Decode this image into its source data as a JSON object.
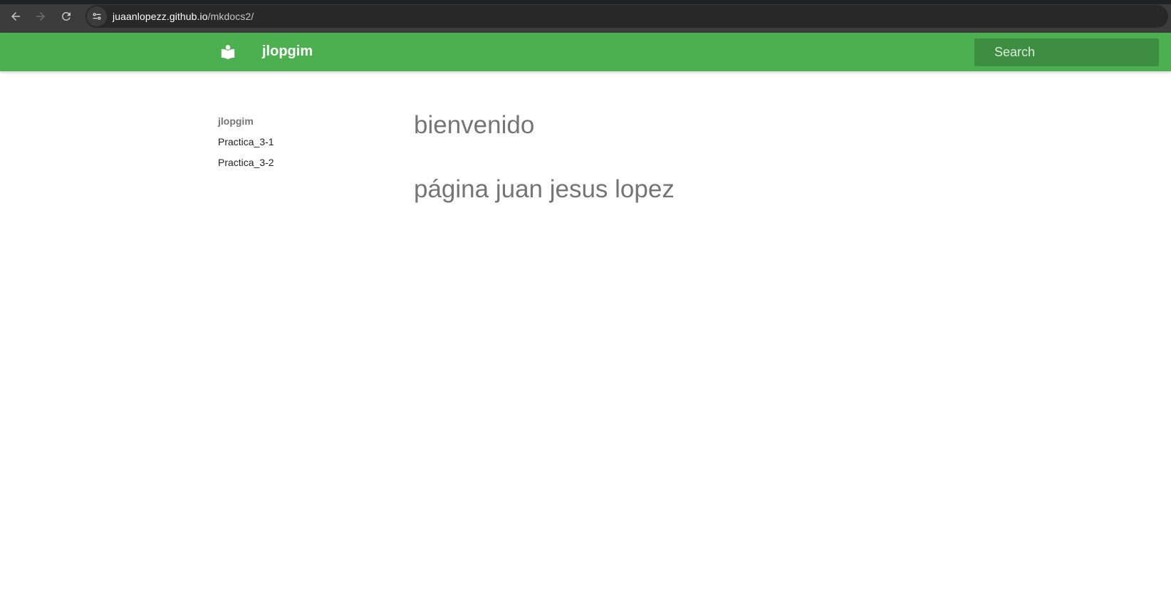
{
  "browser": {
    "url_host": "juaanlopezz.github.io",
    "url_path": "/mkdocs2/",
    "back_icon": "arrow-left-icon",
    "forward_icon": "arrow-right-icon",
    "reload_icon": "reload-icon",
    "site_info_icon": "tune-icon"
  },
  "header": {
    "logo_icon": "book-reader-icon",
    "title": "jlopgim",
    "search_placeholder": "Search",
    "search_icon": "search-icon",
    "background_color": "#4caf50"
  },
  "sidebar": {
    "items": [
      {
        "label": "jlopgim",
        "active": true
      },
      {
        "label": "Practica_3-1",
        "active": false
      },
      {
        "label": "Practica_3-2",
        "active": false
      }
    ]
  },
  "content": {
    "headings": [
      "bienvenido",
      "página juan jesus lopez"
    ]
  }
}
